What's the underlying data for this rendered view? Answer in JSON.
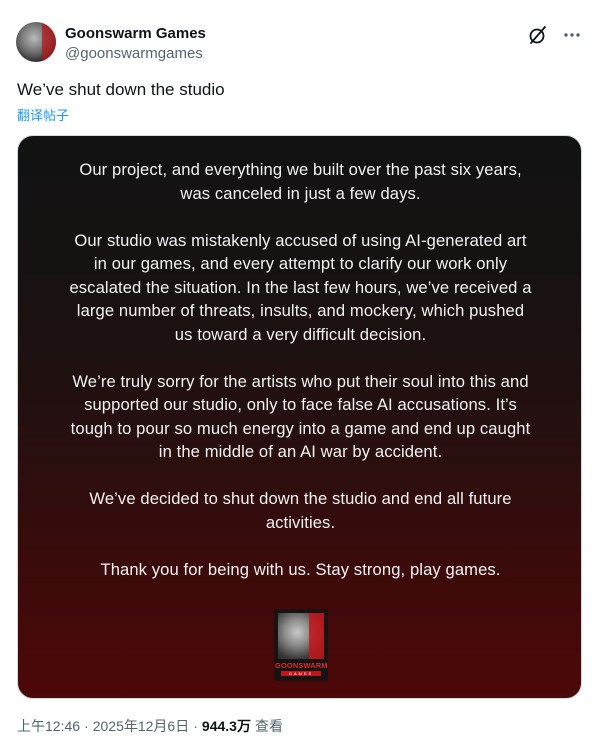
{
  "author": {
    "name": "Goonswarm Games",
    "handle": "@goonswarmgames"
  },
  "header_icons": [
    "grok-slash-icon",
    "more-dots-icon"
  ],
  "post": {
    "text": "We’ve shut down the studio",
    "translate_link": "翻译帖子"
  },
  "media": {
    "paragraphs": [
      "Our project, and everything we built over the past six years,\nwas canceled in just a few days.",
      "Our studio was mistakenly accused of using AI-generated art\nin our games, and every attempt to clarify our work only\nescalated the situation. In the last few hours, we’ve received a\nlarge number of threats, insults, and mockery, which pushed\nus toward a very difficult decision.",
      "We’re truly sorry for the artists who put their soul into this and\nsupported our studio, only to face false AI accusations. It’s\ntough to pour so much energy into a game and end up caught\nin the middle of an AI war by accident.",
      "We’ve decided to shut down the studio and end all future\nactivities.",
      "Thank you for being with us. Stay strong, play games."
    ],
    "logo_text": "GOONSWARM",
    "logo_subtext": "GAMES"
  },
  "meta": {
    "time": "上午12:46",
    "date": "2025年12月6日",
    "separator": "·",
    "views": "944.3万",
    "views_label": "查看"
  }
}
